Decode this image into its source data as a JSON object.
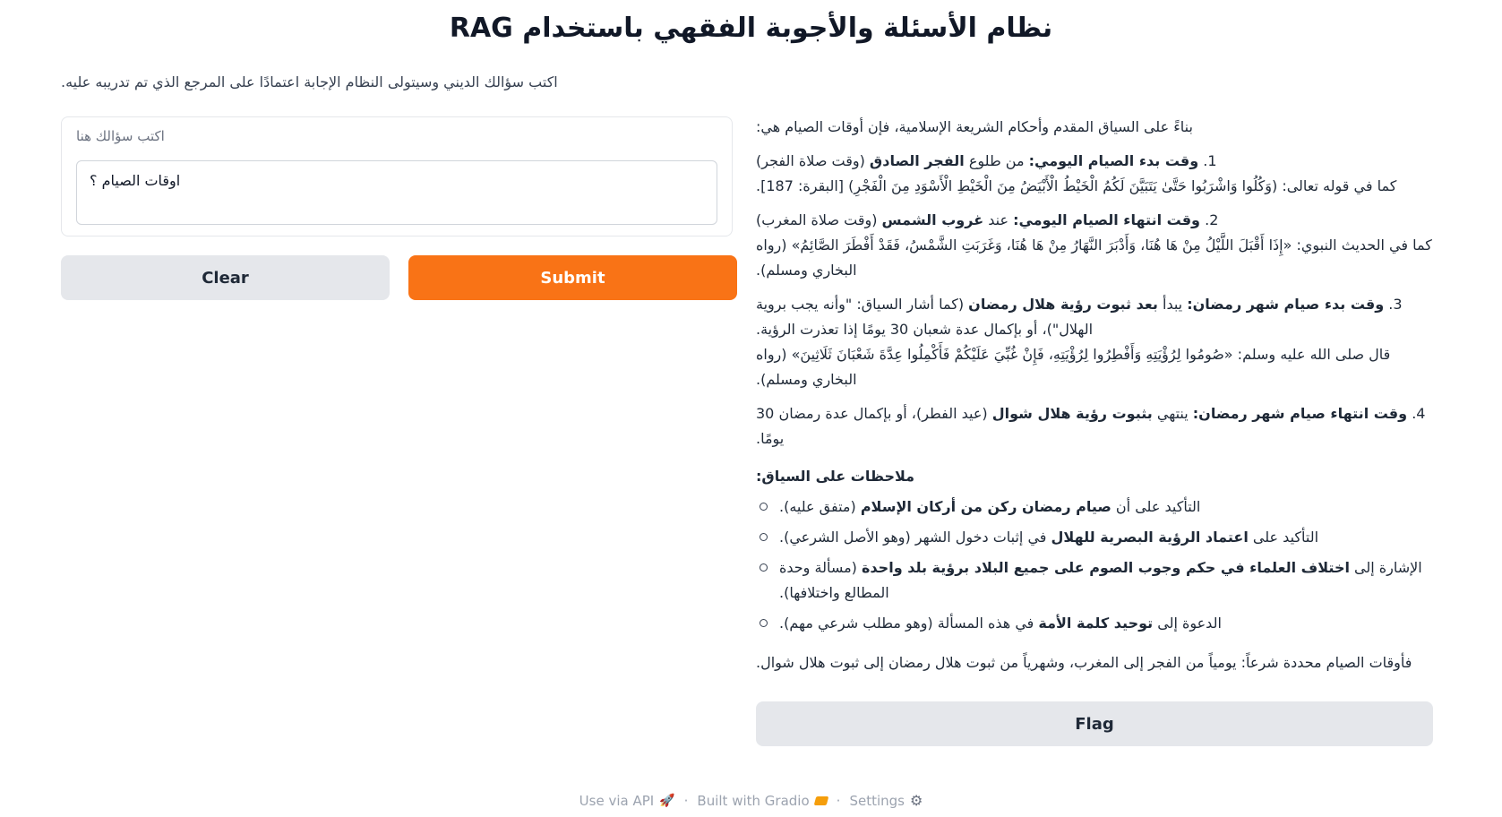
{
  "header": {
    "title": "RAG نظام الأسئلة والأجوبة الفقهي باستخدام",
    "subtitle": "اكتب سؤالك الديني وسيتولى النظام الإجابة اعتمادًا على المرجع الذي تم تدريبه عليه."
  },
  "input": {
    "label": "اكتب سؤالك هنا",
    "value": "اوقات الصيام ؟"
  },
  "buttons": {
    "clear": "Clear",
    "submit": "Submit",
    "flag": "Flag"
  },
  "answer": {
    "intro": "بناءً على السياق المقدم وأحكام الشريعة الإسلامية، فإن أوقات الصيام هي:",
    "items": [
      {
        "num": "1.",
        "bold1": "وقت بدء الصيام اليومي:",
        "text1": " من طلوع ",
        "bold2": "الفجر الصادق",
        "text2": " (وقت صلاة الفجر)",
        "extra": "كما في قوله تعالى: (وَكُلُوا وَاشْرَبُوا حَتَّىٰ يَتَبَيَّنَ لَكُمُ الْخَيْطُ الْأَبْيَضُ مِنَ الْخَيْطِ الْأَسْوَدِ مِنَ الْفَجْرِ) [البقرة: 187]."
      },
      {
        "num": "2.",
        "bold1": "وقت انتهاء الصيام اليومي:",
        "text1": " عند ",
        "bold2": "غروب الشمس",
        "text2": " (وقت صلاة المغرب)",
        "extra": "كما في الحديث النبوي: «إِذَا أَقْبَلَ اللَّيْلُ مِنْ هَا هُنَا، وَأَدْبَرَ النَّهَارُ مِنْ هَا هُنَا، وَغَرَبَتِ الشَّمْسُ، فَقَدْ أَفْطَرَ الصَّائِمُ» (رواه البخاري ومسلم)."
      },
      {
        "num": "3.",
        "bold1": "وقت بدء صيام شهر رمضان:",
        "text1": " يبدأ ",
        "bold2": "بعد ثبوت رؤية هلال رمضان",
        "text2": " (كما أشار السياق: \"وأنه يجب بروية الهلال\")، أو بإكمال عدة شعبان 30 يومًا إذا تعذرت الرؤية.",
        "extra": "قال صلى الله عليه وسلم: «صُومُوا لِرُؤْيَتِهِ وَأَفْطِرُوا لِرُؤْيَتِهِ، فَإِنْ غُبِّيَ عَلَيْكُمْ فَأَكْمِلُوا عِدَّةَ شَعْبَانَ ثَلَاثِينَ» (رواه البخاري ومسلم)."
      },
      {
        "num": "4.",
        "bold1": "وقت انتهاء صيام شهر رمضان:",
        "text1": " ينتهي ",
        "bold2": "بثبوت رؤية هلال شوال",
        "text2": " (عيد الفطر)، أو بإكمال عدة رمضان 30 يومًا.",
        "extra": ""
      }
    ],
    "notes_title": "ملاحظات على السياق:",
    "notes": [
      {
        "pre": "التأكيد على أن ",
        "bold": "صيام رمضان ركن من أركان الإسلام",
        "post": " (متفق عليه)."
      },
      {
        "pre": "التأكيد على ",
        "bold": "اعتماد الرؤية البصرية للهلال",
        "post": " في إثبات دخول الشهر (وهو الأصل الشرعي)."
      },
      {
        "pre": "الإشارة إلى ",
        "bold": "اختلاف العلماء في حكم وجوب الصوم على جميع البلاد برؤية بلد واحدة",
        "post": " (مسألة وحدة المطالع واختلافها)."
      },
      {
        "pre": "الدعوة إلى ",
        "bold": "توحيد كلمة الأمة",
        "post": " في هذه المسألة (وهو مطلب شرعي مهم)."
      }
    ],
    "conclusion": "فأوقات الصيام محددة شرعاً: يومياً من الفجر إلى المغرب، وشهرياً من ثبوت هلال رمضان إلى ثبوت هلال شوال."
  },
  "footer": {
    "api": "Use via API",
    "built": "Built with Gradio",
    "settings": "Settings",
    "separator": "·"
  }
}
